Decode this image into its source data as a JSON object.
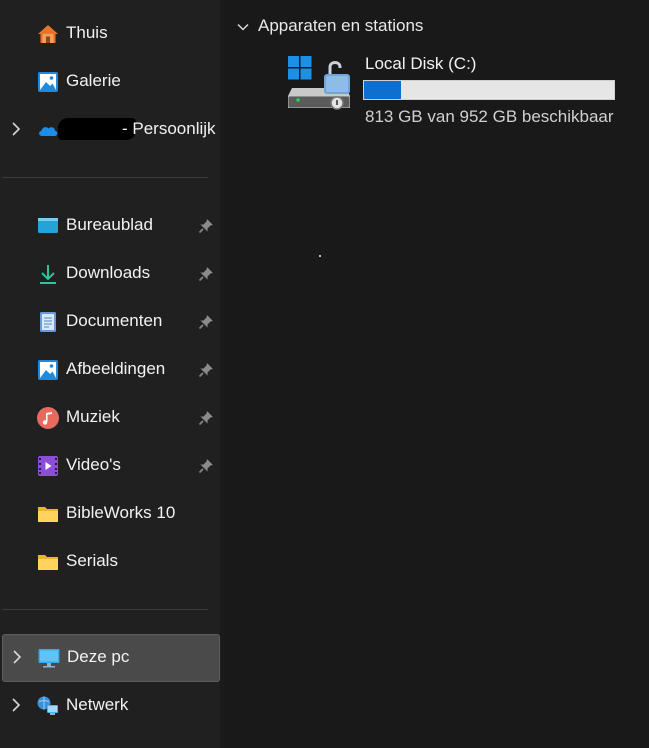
{
  "sidebar": {
    "quick": [
      {
        "label": "Thuis",
        "icon": "home-icon"
      },
      {
        "label": "Galerie",
        "icon": "gallery-icon"
      },
      {
        "label": "- Persoonlijk",
        "icon": "onedrive-cloud-icon"
      }
    ],
    "pinned": [
      {
        "label": "Bureaublad",
        "icon": "desktop-folder-icon",
        "pinned": true
      },
      {
        "label": "Downloads",
        "icon": "download-arrow-icon",
        "pinned": true
      },
      {
        "label": "Documenten",
        "icon": "document-icon",
        "pinned": true
      },
      {
        "label": "Afbeeldingen",
        "icon": "pictures-icon",
        "pinned": true
      },
      {
        "label": "Muziek",
        "icon": "music-icon",
        "pinned": true
      },
      {
        "label": "Video's",
        "icon": "video-icon",
        "pinned": true
      },
      {
        "label": "BibleWorks 10",
        "icon": "folder-icon",
        "pinned": false
      },
      {
        "label": "Serials",
        "icon": "folder-icon",
        "pinned": false
      }
    ],
    "locations": [
      {
        "label": "Deze pc",
        "icon": "this-pc-monitor-icon",
        "selected": true
      },
      {
        "label": "Netwerk",
        "icon": "network-icon",
        "selected": false
      }
    ]
  },
  "main": {
    "section_title": "Apparaten en stations",
    "drives": [
      {
        "name": "Local Disk (C:)",
        "free_text": "813 GB van 952 GB beschikbaar",
        "used_fraction": 0.146
      }
    ]
  },
  "colors": {
    "sidebar_bg": "#202020",
    "main_bg": "#191919",
    "selected_bg": "#4a4a4a",
    "usage_bar": "#0f6fd0"
  }
}
